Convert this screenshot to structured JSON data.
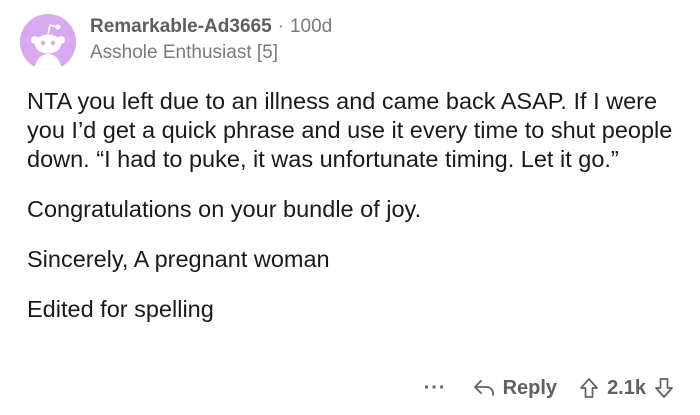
{
  "comment": {
    "author": "Remarkable-Ad3665",
    "separator": "·",
    "age": "100d",
    "flair": "Asshole Enthusiast [5]",
    "body": [
      "NTA you left due to an illness and came back ASAP. If I were you I’d get a quick phrase and use it every time to shut people down. “I had to puke, it was unfortunate timing. Let it go.”",
      "Congratulations on your bundle of joy.",
      "Sincerely, A pregnant woman",
      "Edited for spelling"
    ],
    "avatar_color": "#d9a9ef"
  },
  "actions": {
    "more_label": "···",
    "reply_label": "Reply",
    "score": "2.1k",
    "icons": {
      "reply": "reply-arrow-icon",
      "upvote": "upvote-arrow-icon",
      "downvote": "downvote-arrow-icon",
      "avatar": "snoo-avatar-icon"
    }
  },
  "colors": {
    "text": "#1a1a1b",
    "meta": "#787c7e",
    "background": "#ffffff"
  }
}
